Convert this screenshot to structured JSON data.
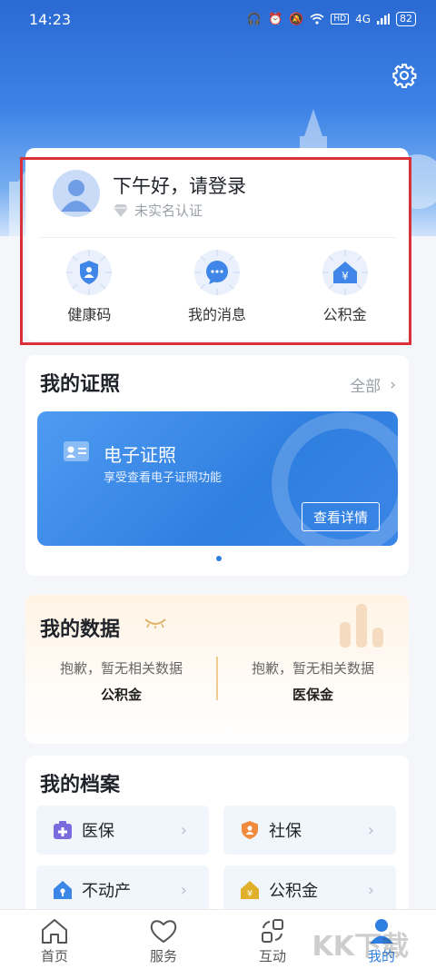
{
  "status_bar": {
    "time": "14:23",
    "network": "4G",
    "battery": "82"
  },
  "profile": {
    "greeting": "下午好，请登录",
    "verify_status": "未实名认证",
    "quick_actions": [
      {
        "label": "健康码",
        "icon": "shield-person-icon"
      },
      {
        "label": "我的消息",
        "icon": "chat-bubble-icon"
      },
      {
        "label": "公积金",
        "icon": "yen-house-icon"
      }
    ]
  },
  "licenses": {
    "title": "我的证照",
    "all_label": "全部",
    "banner_title": "电子证照",
    "banner_subtitle": "享受查看电子证照功能",
    "banner_button": "查看详情"
  },
  "my_data": {
    "title": "我的数据",
    "columns": [
      {
        "message": "抱歉，暂无相关数据",
        "name": "公积金"
      },
      {
        "message": "抱歉，暂无相关数据",
        "name": "医保金"
      }
    ]
  },
  "archives": {
    "title": "我的档案",
    "items": [
      {
        "label": "医保",
        "icon": "medical-cross-icon",
        "color": "#7b6bdc"
      },
      {
        "label": "社保",
        "icon": "shield-person-icon",
        "color": "#f08a3c"
      },
      {
        "label": "不动产",
        "icon": "house-key-icon",
        "color": "#3b86e6"
      },
      {
        "label": "公积金",
        "icon": "yen-house-icon",
        "color": "#e0b02a"
      }
    ]
  },
  "tabbar": {
    "items": [
      {
        "label": "首页",
        "icon": "home-icon"
      },
      {
        "label": "服务",
        "icon": "heart-icon"
      },
      {
        "label": "互动",
        "icon": "interact-icon"
      },
      {
        "label": "我的",
        "icon": "person-icon",
        "active": true
      }
    ]
  },
  "watermark": "KK下载",
  "colors": {
    "primary": "#2f7fe0",
    "highlight_border": "#d9303a"
  }
}
